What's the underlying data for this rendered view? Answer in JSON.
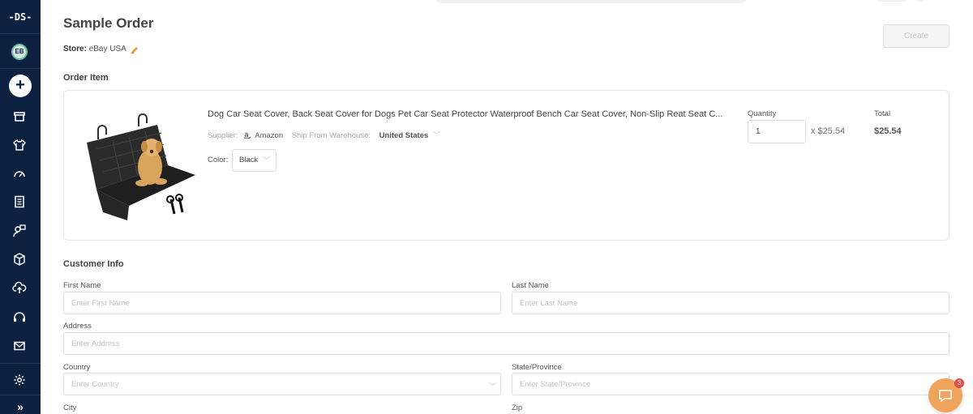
{
  "sidebar": {
    "logo": "-DS-",
    "avatar_initials": "EB",
    "add_label": "+",
    "icons": [
      "store-icon",
      "shirt-icon",
      "dashboard-gauge-icon",
      "orders-list-icon",
      "user-support-icon",
      "package-icon",
      "upload-cloud-icon",
      "headset-icon",
      "mail-icon",
      "settings-gear-icon",
      "expand-chevrons-icon"
    ],
    "expand_label": "»"
  },
  "header": {
    "title": "Sample Order",
    "store_label": "Store:",
    "store_value": "eBay USA",
    "create_button": "Create"
  },
  "order_item": {
    "section_title": "Order Item",
    "product_title": "Dog Car Seat Cover, Back Seat Cover for Dogs Pet Car Seat Protector Waterproof Bench Car Seat Cover, Non-Slip Reat Seat C...",
    "supplier_label": "Supplier:",
    "supplier_value": "Amazon",
    "warehouse_label": "Ship From Warehouse:",
    "warehouse_value": "United States",
    "color_label": "Color:",
    "color_value": "Black",
    "quantity_label": "Quantity",
    "quantity_value": "1",
    "unit_price": "x $25.54",
    "total_label": "Total",
    "total_value": "$25.54"
  },
  "customer_info": {
    "section_title": "Customer Info",
    "first_name_label": "First Name",
    "first_name_placeholder": "Enter First Name",
    "last_name_label": "Last Name",
    "last_name_placeholder": "Enter Last Name",
    "address_label": "Address",
    "address_placeholder": "Enter Address",
    "country_label": "Country",
    "country_placeholder": "Enter Country",
    "state_label": "State/Province",
    "state_placeholder": "Enter State/Province",
    "city_label": "City",
    "zip_label": "Zip"
  },
  "chat": {
    "badge_count": "3"
  },
  "colors": {
    "sidebar_bg": "#0c2140",
    "accent_orange": "#f0a35a",
    "badge_red": "#e24b4b"
  }
}
